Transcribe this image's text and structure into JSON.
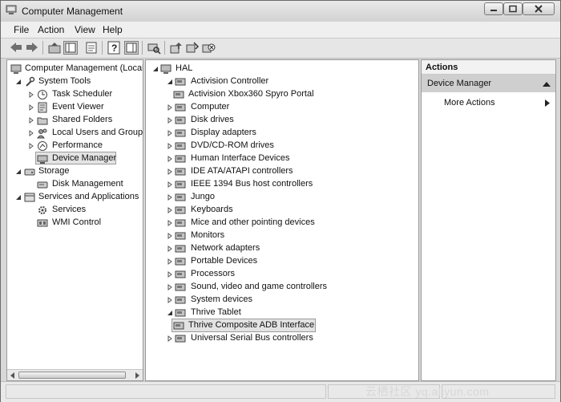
{
  "window": {
    "title": "Computer Management"
  },
  "menu": {
    "file": "File",
    "action": "Action",
    "view": "View",
    "help": "Help"
  },
  "toolbar": {
    "icons": [
      "back-arrow-icon",
      "forward-arrow-icon",
      "up-folder-icon",
      "show-hide-tree-icon",
      "properties-icon",
      "help-icon",
      "show-hide-action-pane-icon",
      "scan-hardware-icon",
      "update-driver-icon",
      "disable-device-icon",
      "uninstall-device-icon"
    ]
  },
  "tree": {
    "root": "Computer Management (Local",
    "system_tools": "System Tools",
    "task_scheduler": "Task Scheduler",
    "event_viewer": "Event Viewer",
    "shared_folders": "Shared Folders",
    "local_users": "Local Users and Groups",
    "performance": "Performance",
    "device_manager": "Device Manager",
    "storage": "Storage",
    "disk_management": "Disk Management",
    "services_apps": "Services and Applications",
    "services": "Services",
    "wmi": "WMI Control"
  },
  "devices": {
    "root": "HAL",
    "items": [
      {
        "label": "Activision Controller",
        "icon": "controller-icon",
        "expanded": true
      },
      {
        "label": "Activision Xbox360 Spyro Portal",
        "icon": "device-icon",
        "child": true
      },
      {
        "label": "Computer",
        "icon": "computer-icon"
      },
      {
        "label": "Disk drives",
        "icon": "disk-drive-icon"
      },
      {
        "label": "Display adapters",
        "icon": "display-adapter-icon"
      },
      {
        "label": "DVD/CD-ROM drives",
        "icon": "dvd-drive-icon"
      },
      {
        "label": "Human Interface Devices",
        "icon": "hid-icon"
      },
      {
        "label": "IDE ATA/ATAPI controllers",
        "icon": "ide-controller-icon"
      },
      {
        "label": "IEEE 1394 Bus host controllers",
        "icon": "ieee1394-icon"
      },
      {
        "label": "Jungo",
        "icon": "jungo-icon"
      },
      {
        "label": "Keyboards",
        "icon": "keyboard-icon"
      },
      {
        "label": "Mice and other pointing devices",
        "icon": "mouse-icon"
      },
      {
        "label": "Monitors",
        "icon": "monitor-icon"
      },
      {
        "label": "Network adapters",
        "icon": "network-adapter-icon"
      },
      {
        "label": "Portable Devices",
        "icon": "portable-device-icon"
      },
      {
        "label": "Processors",
        "icon": "processor-icon"
      },
      {
        "label": "Sound, video and game controllers",
        "icon": "sound-icon"
      },
      {
        "label": "System devices",
        "icon": "system-devices-icon"
      },
      {
        "label": "Thrive Tablet",
        "icon": "tablet-icon",
        "expanded": true
      },
      {
        "label": "Thrive Composite ADB Interface",
        "icon": "device-icon",
        "child": true,
        "selected": true
      },
      {
        "label": "Universal Serial Bus controllers",
        "icon": "usb-icon"
      }
    ]
  },
  "actions": {
    "header": "Actions",
    "section": "Device Manager",
    "more": "More Actions"
  },
  "watermark": "云栖社区 yq.aliyun.com"
}
